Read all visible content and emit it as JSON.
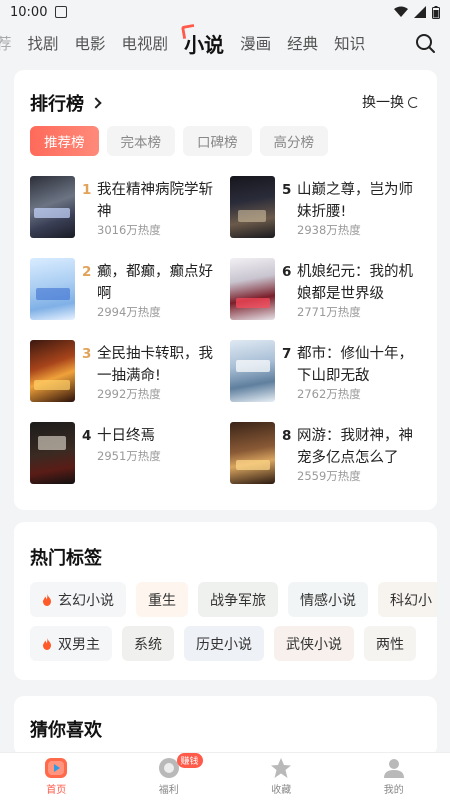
{
  "status": {
    "time": "10:00"
  },
  "top_tabs": [
    {
      "label": "荐",
      "faded": true
    },
    {
      "label": "找剧"
    },
    {
      "label": "电影"
    },
    {
      "label": "电视剧"
    },
    {
      "label": "小说",
      "active": true
    },
    {
      "label": "漫画"
    },
    {
      "label": "经典"
    },
    {
      "label": "知识"
    }
  ],
  "ranking": {
    "title": "排行榜",
    "swap_label": "换一换",
    "chips": [
      "推荐榜",
      "完本榜",
      "口碑榜",
      "高分榜"
    ],
    "books": [
      {
        "rank": "1",
        "title": "我在精神病院学斩神",
        "heat": "3016万热度"
      },
      {
        "rank": "2",
        "title": "癫，都癫，癫点好啊",
        "heat": "2994万热度"
      },
      {
        "rank": "3",
        "title": "全民抽卡转职，我一抽满命!",
        "heat": "2992万热度"
      },
      {
        "rank": "4",
        "title": "十日终焉",
        "heat": "2951万热度"
      },
      {
        "rank": "5",
        "title": "山巅之尊，岂为师妹折腰!",
        "heat": "2938万热度"
      },
      {
        "rank": "6",
        "title": "机娘纪元：我的机娘都是世界级",
        "heat": "2771万热度"
      },
      {
        "rank": "7",
        "title": "都市：修仙十年，下山即无敌",
        "heat": "2762万热度"
      },
      {
        "rank": "8",
        "title": "网游：我财神，神宠多亿点怎么了",
        "heat": "2559万热度"
      }
    ]
  },
  "hot_tags": {
    "title": "热门标签",
    "row1": [
      "玄幻小说",
      "重生",
      "战争军旅",
      "情感小说",
      "科幻小"
    ],
    "row2": [
      "双男主",
      "系统",
      "历史小说",
      "武侠小说",
      "两性"
    ]
  },
  "guess": {
    "title": "猜你喜欢"
  },
  "bottom_nav": [
    {
      "label": "首页",
      "active": true
    },
    {
      "label": "福利",
      "badge": "赚钱"
    },
    {
      "label": "收藏"
    },
    {
      "label": "我的"
    }
  ],
  "colors": {
    "accent": "#ff5a4a",
    "rank_gold": "#e1a35a",
    "background": "#f3f4f6"
  }
}
